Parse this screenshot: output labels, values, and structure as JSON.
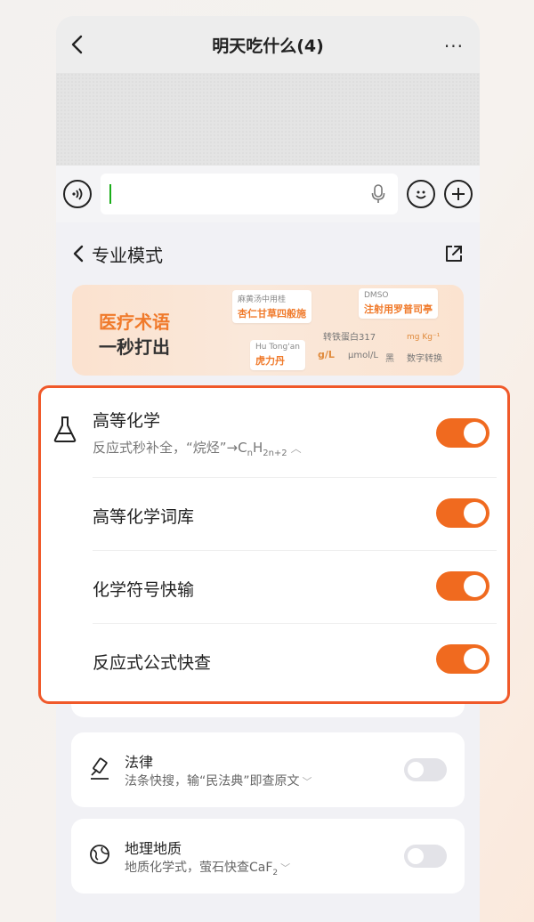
{
  "header": {
    "title": "明天吃什么(4)",
    "more": "···"
  },
  "mode": {
    "title": "专业模式"
  },
  "banner": {
    "line1": "医疗术语",
    "line2": "一秒打出",
    "chips": {
      "c1_small": "麻黄汤中用桂",
      "c1_big": "杏仁甘草四般施",
      "c2_small": "DMSO",
      "c2_big": "注射用罗普司亭",
      "c3": "转铁蛋白317",
      "c4": "mg Kg⁻¹",
      "c5": "Hu Tong'an",
      "c5b": "虎力丹",
      "u1": "g/L",
      "u2": "μmol/L",
      "u3": "黑",
      "u4": "数字转换"
    }
  },
  "chemistry": {
    "title": "高等化学",
    "subtitle_prefix": "反应式秒补全，“烷烃”→C",
    "sub_n": "n",
    "subtitle_H": "H",
    "sub_2n2": "2n+2",
    "caret": "︿",
    "items": [
      {
        "label": "高等化学词库"
      },
      {
        "label": "化学符号快输"
      },
      {
        "label": "反应式公式快查"
      }
    ]
  },
  "law": {
    "title": "法律",
    "subtitle": "法条快搜，输“民法典”即查原文",
    "caret": "﹀"
  },
  "geo": {
    "title": "地理地质",
    "subtitle_prefix": "地质化学式，萤石快查CaF",
    "sub2": "2",
    "caret": "﹀"
  },
  "colors": {
    "accent": "#f06a1f",
    "highlight_border": "#f0592a"
  }
}
